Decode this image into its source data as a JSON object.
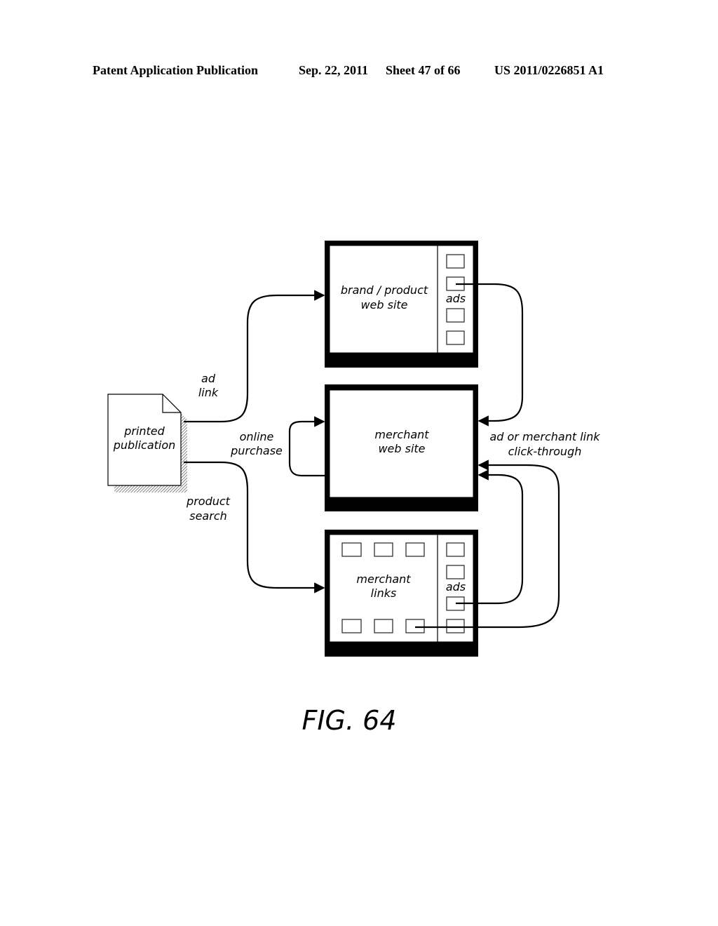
{
  "header": {
    "publication": "Patent Application Publication",
    "date": "Sep. 22, 2011",
    "sheet": "Sheet 47 of 66",
    "number": "US 2011/0226851 A1"
  },
  "diagram": {
    "nodes": {
      "printed_publication": {
        "line1": "printed",
        "line2": "publication",
        "icon": "document-icon"
      },
      "brand_site": {
        "line1": "brand / product",
        "line2": "web site",
        "side_label": "ads",
        "ad_slots": 4
      },
      "merchant_site": {
        "line1": "merchant",
        "line2": "web site"
      },
      "merchant_links": {
        "line1": "merchant",
        "line2": "links",
        "side_label": "ads",
        "link_slots": 6,
        "ad_slots": 4
      }
    },
    "edges": {
      "ad_link": {
        "line1": "ad",
        "line2": "link",
        "from": "printed publication",
        "to": "brand / product web site"
      },
      "product_search": {
        "line1": "product",
        "line2": "search",
        "from": "printed publication",
        "to": "merchant links"
      },
      "online_purchase": {
        "line1": "online",
        "line2": "purchase",
        "from": "merchant web site",
        "to": "merchant web site"
      },
      "click_through": {
        "line1": "ad or merchant link",
        "line2": "click-through",
        "to": "merchant web site"
      }
    }
  },
  "caption": "FIG. 64"
}
